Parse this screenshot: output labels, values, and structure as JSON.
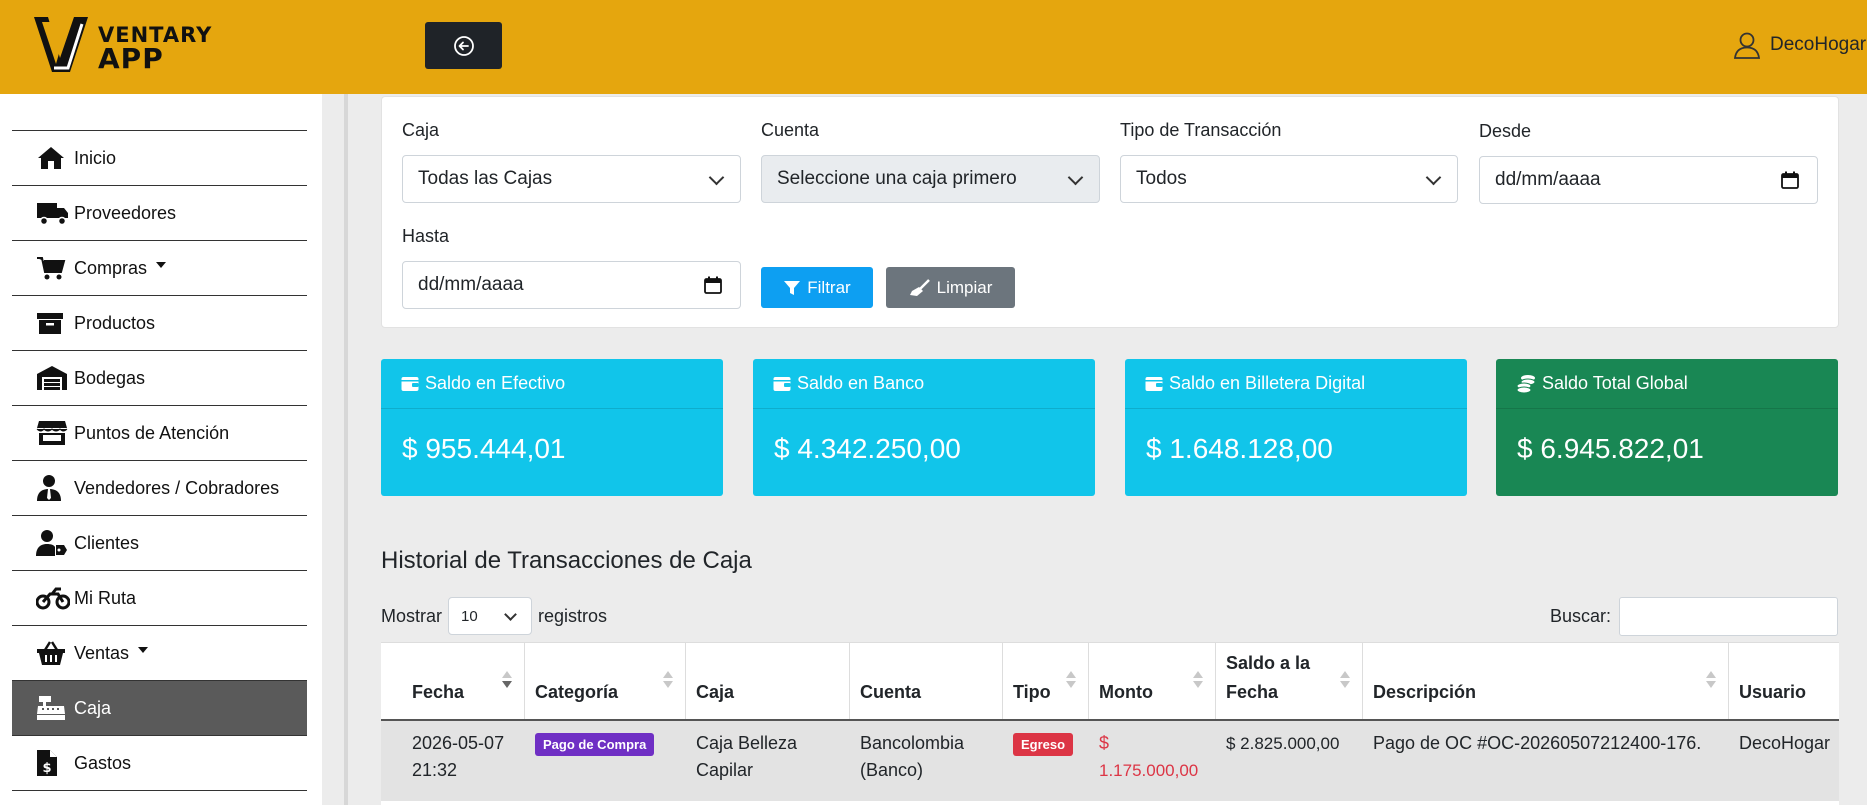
{
  "header": {
    "logo_text_line1": "VENTARY",
    "logo_text_line2": "APP",
    "toggle_icon": "arrow-left-circle-icon",
    "user_name": "DecoHogar",
    "brand_color": "#e5a60e"
  },
  "sidebar": {
    "items": [
      {
        "label": "Inicio",
        "icon": "home-icon"
      },
      {
        "label": "Proveedores",
        "icon": "truck-icon"
      },
      {
        "label": "Compras",
        "icon": "cart-icon",
        "dropdown": true
      },
      {
        "label": "Productos",
        "icon": "archive-box-icon"
      },
      {
        "label": "Bodegas",
        "icon": "warehouse-icon"
      },
      {
        "label": "Puntos de Atención",
        "icon": "store-icon"
      },
      {
        "label": "Vendedores / Cobradores",
        "icon": "user-tie-icon"
      },
      {
        "label": "Clientes",
        "icon": "user-tag-icon"
      },
      {
        "label": "Mi Ruta",
        "icon": "motorcycle-icon"
      },
      {
        "label": "Ventas",
        "icon": "basket-icon",
        "dropdown": true
      },
      {
        "label": "Caja",
        "icon": "cash-register-icon",
        "active": true
      },
      {
        "label": "Gastos",
        "icon": "invoice-dollar-icon"
      }
    ]
  },
  "filters": {
    "caja_label": "Caja",
    "caja_value": "Todas las Cajas",
    "cuenta_label": "Cuenta",
    "cuenta_value": "Seleccione una caja primero",
    "tipo_label": "Tipo de Transacción",
    "tipo_value": "Todos",
    "desde_label": "Desde",
    "desde_value": "dd/mm/aaaa",
    "hasta_label": "Hasta",
    "hasta_value": "dd/mm/aaaa",
    "filter_button": "Filtrar",
    "clear_button": "Limpiar"
  },
  "balances": [
    {
      "label": "Saldo en Efectivo",
      "value": "$ 955.444,01",
      "color": "#11c5ea",
      "icon": "wallet-icon"
    },
    {
      "label": "Saldo en Banco",
      "value": "$ 4.342.250,00",
      "color": "#11c5ea",
      "icon": "wallet-icon"
    },
    {
      "label": "Saldo en Billetera Digital",
      "value": "$ 1.648.128,00",
      "color": "#11c5ea",
      "icon": "wallet-icon"
    },
    {
      "label": "Saldo Total Global",
      "value": "$ 6.945.822,01",
      "color": "#198754",
      "icon": "coins-icon"
    }
  ],
  "history": {
    "title": "Historial de Transacciones de Caja",
    "show_label": "Mostrar",
    "length_value": "10",
    "records_label": "registros",
    "search_label": "Buscar:",
    "columns": [
      "Fecha",
      "Categoría",
      "Caja",
      "Cuenta",
      "Tipo",
      "Monto",
      "Saldo a la Fecha",
      "Descripción",
      "Usuario"
    ],
    "rows": [
      {
        "fecha_date": "2026-05-07",
        "fecha_time": "21:32",
        "categoria": "Pago de Compra",
        "caja_line1": "Caja Belleza",
        "caja_line2": "Capilar",
        "cuenta_line1": "Bancolombia",
        "cuenta_line2": "(Banco)",
        "tipo": "Egreso",
        "monto_line1": "$",
        "monto_line2": "1.175.000,00",
        "saldo": "$ 2.825.000,00",
        "descripcion": "Pago de OC #OC-20260507212400-176.",
        "usuario": "DecoHogar"
      }
    ]
  }
}
